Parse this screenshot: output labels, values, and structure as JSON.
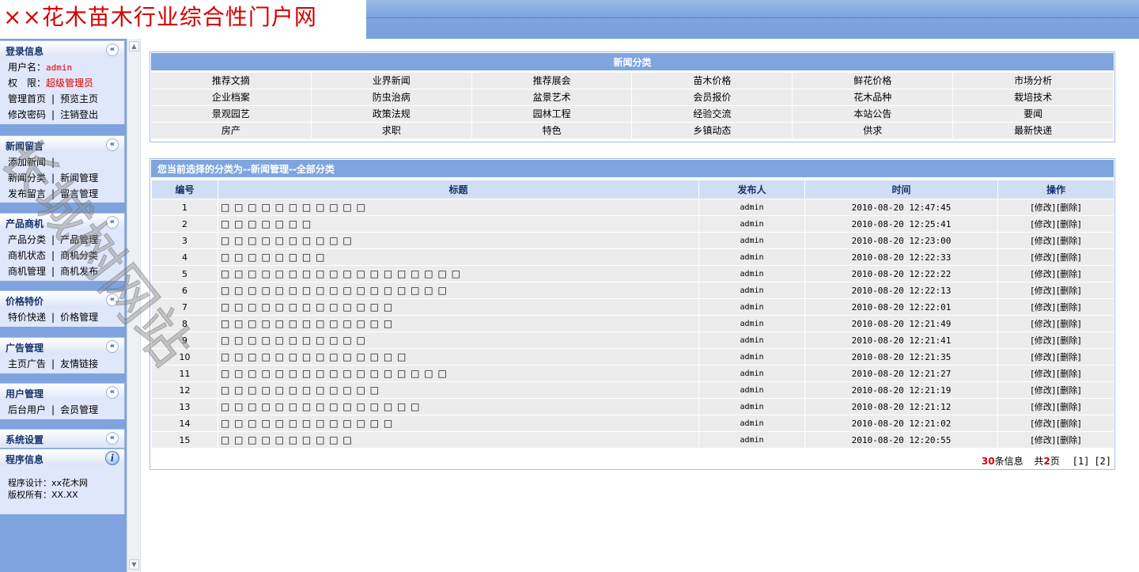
{
  "header": {
    "site_title": "××花木苗木行业综合性门户网"
  },
  "sidebar": {
    "login": {
      "title": "登录信息",
      "user_label": "用户名：",
      "user_value": "admin",
      "perm_label": "权　限：",
      "perm_value": "超级管理员",
      "rows": [
        [
          "管理首页",
          "预览主页"
        ],
        [
          "修改密码",
          "注销登出"
        ]
      ]
    },
    "news": {
      "title": "新闻留言",
      "rows": [
        [
          "添加新闻",
          ""
        ],
        [
          "新闻分类",
          "新闻管理"
        ],
        [
          "发布留言",
          "留言管理"
        ]
      ]
    },
    "products": {
      "title": "产品商机",
      "rows": [
        [
          "产品分类",
          "产品管理"
        ],
        [
          "商机状态",
          "商机分类"
        ],
        [
          "商机管理",
          "商机发布"
        ]
      ]
    },
    "prices": {
      "title": "价格特价",
      "rows": [
        [
          "特价快递",
          "价格管理"
        ]
      ]
    },
    "ads": {
      "title": "广告管理",
      "rows": [
        [
          "主页广告",
          "友情链接"
        ]
      ]
    },
    "users": {
      "title": "用户管理",
      "rows": [
        [
          "后台用户",
          "会员管理"
        ]
      ]
    },
    "system": {
      "title": "系统设置"
    },
    "program": {
      "title": "程序信息",
      "designer": "程序设计：xx花木网",
      "copyright": "版权所有：XX.XX"
    }
  },
  "categories": {
    "title": "新闻分类",
    "items": [
      "推荐文摘",
      "业界新闻",
      "推荐展会",
      "苗木价格",
      "鲜花价格",
      "市场分析",
      "企业档案",
      "防虫治病",
      "盆景艺术",
      "会员报价",
      "花木品种",
      "栽培技术",
      "景观园艺",
      "政策法规",
      "园林工程",
      "经验交流",
      "本站公告",
      "要闻",
      "房产",
      "求职",
      "特色",
      "乡镇动态",
      "供求",
      "最新快递"
    ]
  },
  "list": {
    "title": "您当前选择的分类为--新闻管理--全部分类",
    "columns": [
      "编号",
      "标题",
      "发布人",
      "时间",
      "操作"
    ],
    "edit_label": "[修改]",
    "delete_label": "[删除]",
    "rows": [
      {
        "id": "1",
        "title": "□ □ □ □ □ □ □ □ □ □ □",
        "publisher": "admin",
        "time": "2010-08-20 12:47:45"
      },
      {
        "id": "2",
        "title": "□ □ □ □ □ □ □",
        "publisher": "admin",
        "time": "2010-08-20 12:25:41"
      },
      {
        "id": "3",
        "title": "□ □ □ □ □ □ □ □ □ □",
        "publisher": "admin",
        "time": "2010-08-20 12:23:00"
      },
      {
        "id": "4",
        "title": "□ □ □ □ □ □ □ □",
        "publisher": "admin",
        "time": "2010-08-20 12:22:33"
      },
      {
        "id": "5",
        "title": "□ □ □ □ □ □ □ □ □ □ □ □ □ □ □ □ □ □",
        "publisher": "admin",
        "time": "2010-08-20 12:22:22"
      },
      {
        "id": "6",
        "title": "□ □ □ □ □ □ □ □ □ □ □ □ □ □ □ □ □",
        "publisher": "admin",
        "time": "2010-08-20 12:22:13"
      },
      {
        "id": "7",
        "title": "□ □ □ □ □ □ □ □ □ □ □ □ □",
        "publisher": "admin",
        "time": "2010-08-20 12:22:01"
      },
      {
        "id": "8",
        "title": "□ □ □ □ □ □ □ □ □ □ □ □ □",
        "publisher": "admin",
        "time": "2010-08-20 12:21:49"
      },
      {
        "id": "9",
        "title": "□ □ □ □ □ □ □ □ □ □ □",
        "publisher": "admin",
        "time": "2010-08-20 12:21:41"
      },
      {
        "id": "10",
        "title": "□ □ □ □ □ □ □ □ □ □ □ □ □ □",
        "publisher": "admin",
        "time": "2010-08-20 12:21:35"
      },
      {
        "id": "11",
        "title": "□ □ □ □ □ □ □ □ □ □ □ □ □ □ □ □ □",
        "publisher": "admin",
        "time": "2010-08-20 12:21:27"
      },
      {
        "id": "12",
        "title": "□ □ □ □ □ □ □ □ □ □ □ □",
        "publisher": "admin",
        "time": "2010-08-20 12:21:19"
      },
      {
        "id": "13",
        "title": "□ □ □ □ □ □ □ □ □ □ □ □ □ □ □",
        "publisher": "admin",
        "time": "2010-08-20 12:21:12"
      },
      {
        "id": "14",
        "title": "□ □ □ □ □ □ □ □ □ □ □ □ □",
        "publisher": "admin",
        "time": "2010-08-20 12:21:02"
      },
      {
        "id": "15",
        "title": "□ □ □ □ □ □ □ □ □ □",
        "publisher": "admin",
        "time": "2010-08-20 12:20:55"
      }
    ],
    "pager": {
      "total": "30",
      "total_suffix": "条信息",
      "pages_prefix": "共",
      "pages": "2",
      "pages_suffix": "页",
      "page1": "[1]",
      "page2": "[2]"
    }
  },
  "watermark": "长城树网站",
  "colors": {
    "accent": "#7fa5df",
    "brand_red": "#d40000",
    "header_bg": "#d0def5",
    "row_bg": "#ececec"
  }
}
